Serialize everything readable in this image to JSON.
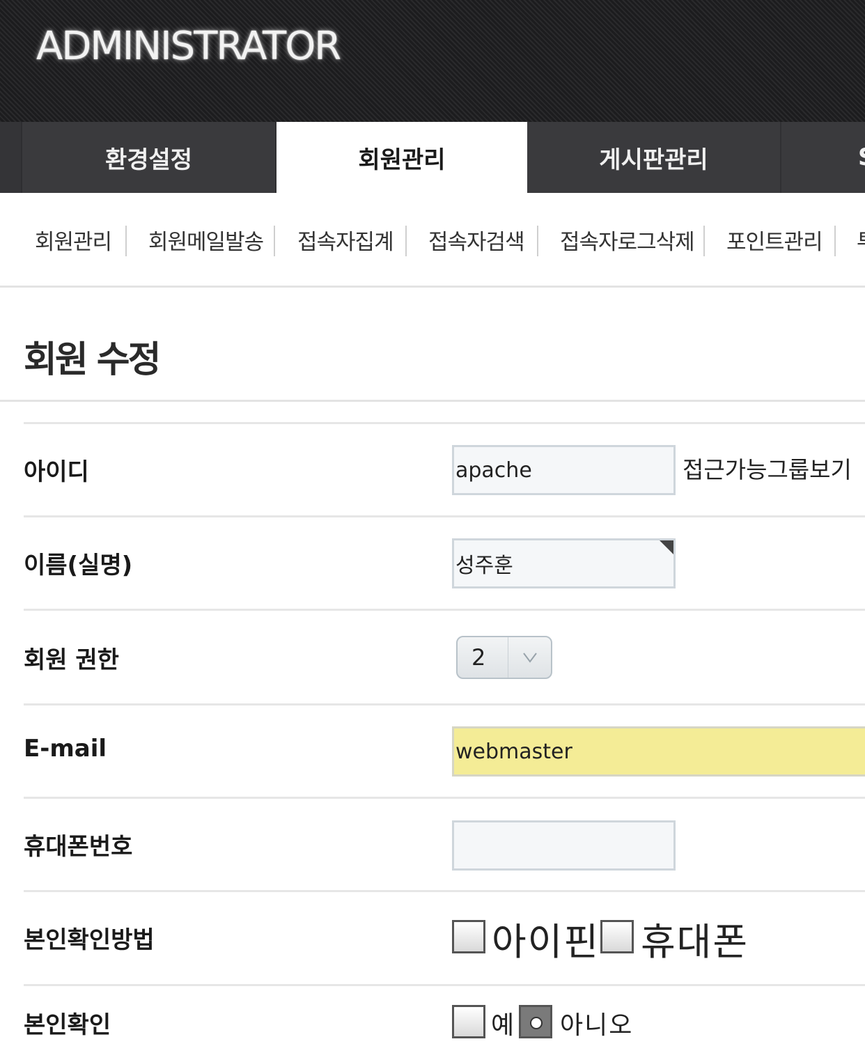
{
  "header": {
    "brand": "ADMINISTRATOR"
  },
  "top_nav": {
    "tabs": [
      {
        "label": "환경설정",
        "active": false
      },
      {
        "label": "회원관리",
        "active": true
      },
      {
        "label": "게시판관리",
        "active": false
      },
      {
        "label": "S",
        "active": false
      }
    ]
  },
  "sub_nav": {
    "items": [
      "회원관리",
      "회원메일발송",
      "접속자집계",
      "접속자검색",
      "접속자로그삭제",
      "포인트관리",
      "투"
    ]
  },
  "page": {
    "title": "회원 수정"
  },
  "form": {
    "id": {
      "label": "아이디",
      "value": "apache",
      "link": "접근가능그룹보기"
    },
    "name": {
      "label": "이름(실명)",
      "value": "성주훈"
    },
    "level": {
      "label": "회원 권한",
      "value": "2"
    },
    "email": {
      "label": "E-mail",
      "value": "webmaster"
    },
    "phone": {
      "label": "휴대폰번호",
      "value": ""
    },
    "cert_method": {
      "label": "본인확인방법",
      "options": [
        "아이핀",
        "휴대폰"
      ]
    },
    "cert": {
      "label": "본인확인",
      "options": [
        "예",
        "아니오"
      ],
      "selected": "아니오"
    }
  },
  "colors": {
    "header_bg": "#1f1f21",
    "nav_bg": "#3a3a3d",
    "email_highlight": "#f4ec96"
  }
}
